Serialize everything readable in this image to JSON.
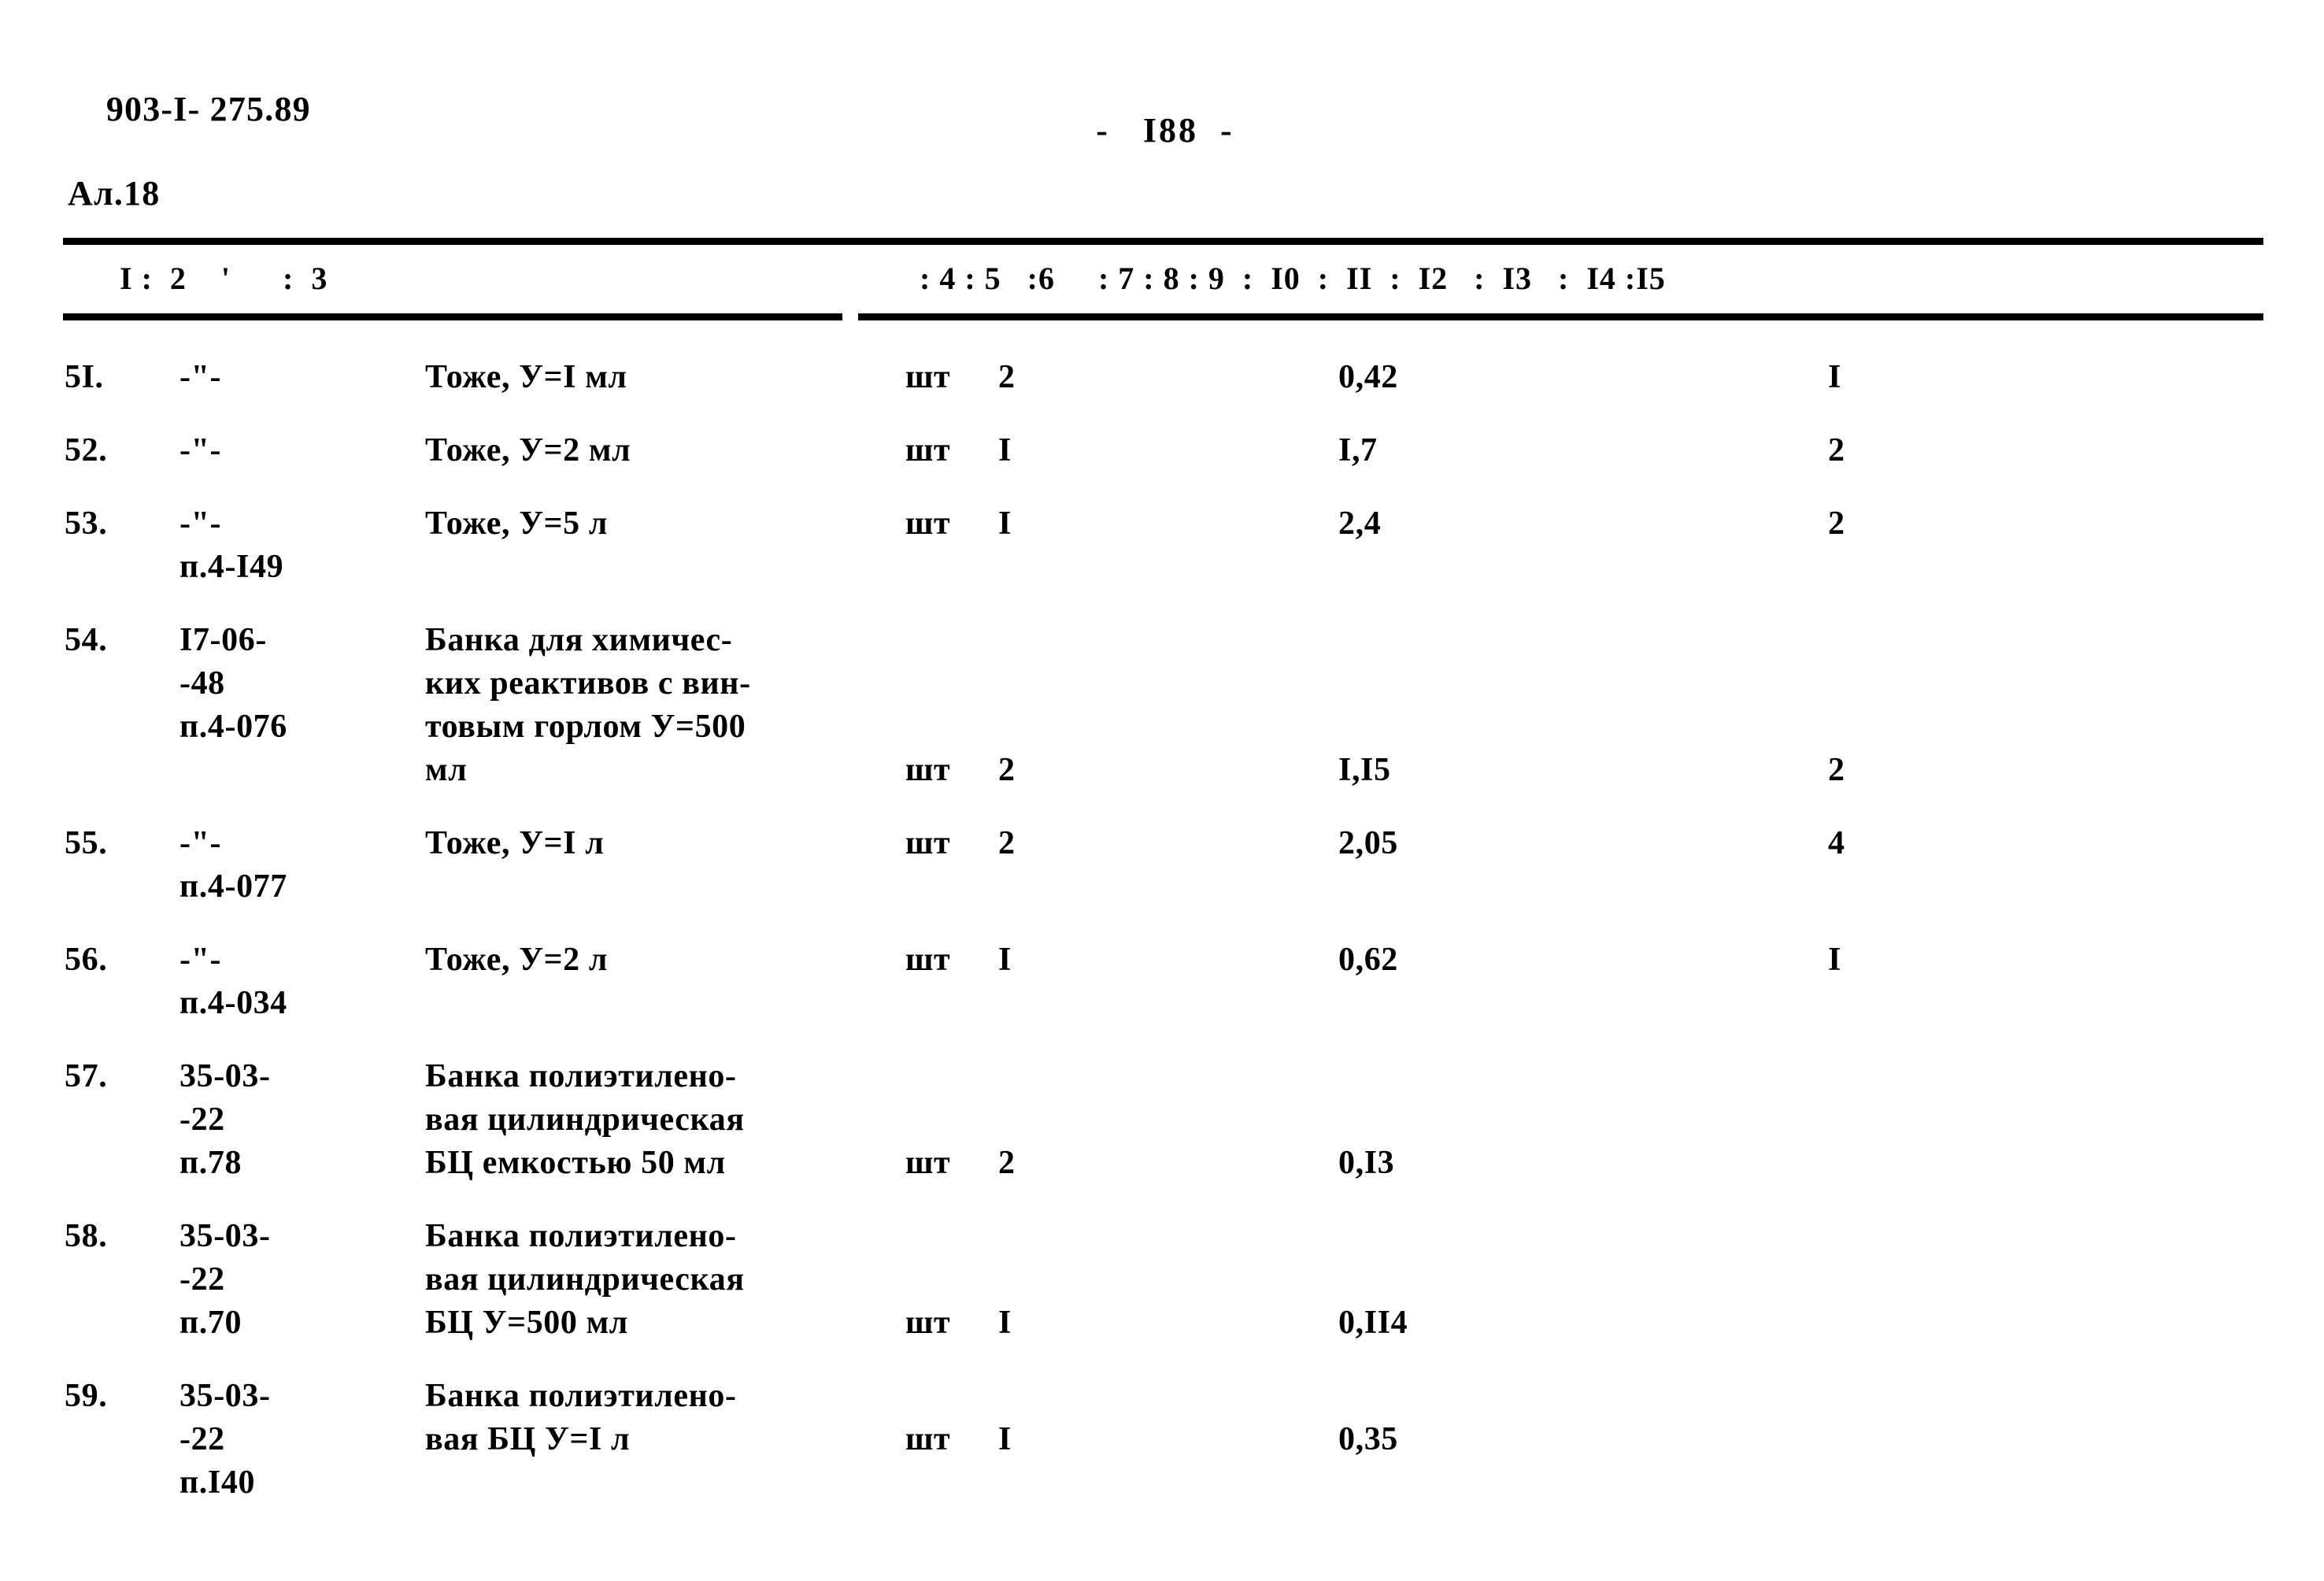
{
  "header": {
    "doc_code_line1": "903-I- 275.89",
    "doc_code_line2": "Ал.18",
    "page_label": "-   I88  -"
  },
  "column_header": {
    "left": "I :  2    '      :  3",
    "right": ": 4 : 5   :6     : 7 : 8 : 9  :  I0  :  II  :  I2   :  I3   :  I4 :I5"
  },
  "table": {
    "rows": [
      {
        "num": "5I.",
        "code": "-\"-",
        "code2": "",
        "desc_lines": [
          "Тоже, У=I мл"
        ],
        "unit": "шт",
        "qty": "2",
        "price": "0,42",
        "col11": "I",
        "unit_line": 0
      },
      {
        "num": "52.",
        "code": "-\"-",
        "code2": "",
        "desc_lines": [
          "Тоже, У=2 мл"
        ],
        "unit": "шт",
        "qty": "I",
        "price": "I,7",
        "col11": "2",
        "unit_line": 0
      },
      {
        "num": "53.",
        "code": "-\"-",
        "code2": "п.4-I49",
        "desc_lines": [
          "Тоже, У=5 л"
        ],
        "unit": "шт",
        "qty": "I",
        "price": "2,4",
        "col11": "2",
        "unit_line": 0
      },
      {
        "num": "54.",
        "code": "I7-06-",
        "code2": "-48\nп.4-076",
        "desc_lines": [
          "Банка для химичес-",
          "ких реактивов с вин-",
          "товым горлом У=500",
          "мл"
        ],
        "unit": "шт",
        "qty": "2",
        "price": "I,I5",
        "col11": "2",
        "unit_line": 3
      },
      {
        "num": "55.",
        "code": "-\"-",
        "code2": "п.4-077",
        "desc_lines": [
          "Тоже, У=I л"
        ],
        "unit": "шт",
        "qty": "2",
        "price": "2,05",
        "col11": "4",
        "unit_line": 0
      },
      {
        "num": "56.",
        "code": "-\"-",
        "code2": "п.4-034",
        "desc_lines": [
          "Тоже, У=2 л"
        ],
        "unit": "шт",
        "qty": "I",
        "price": "0,62",
        "col11": "I",
        "unit_line": 0
      },
      {
        "num": "57.",
        "code": "35-03-",
        "code2": "-22\nп.78",
        "desc_lines": [
          "Банка полиэтилено-",
          "вая цилиндрическая",
          "БЦ емкостью 50 мл"
        ],
        "unit": "шт",
        "qty": "2",
        "price": "0,I3",
        "col11": "",
        "unit_line": 2
      },
      {
        "num": "58.",
        "code": "35-03-",
        "code2": "-22\nп.70",
        "desc_lines": [
          "Банка полиэтилено-",
          "вая цилиндрическая",
          "БЦ У=500 мл"
        ],
        "unit": "шт",
        "qty": "I",
        "price": "0,II4",
        "col11": "",
        "unit_line": 2
      },
      {
        "num": "59.",
        "code": "35-03-",
        "code2": "-22\nп.I40",
        "desc_lines": [
          "Банка полиэтилено-",
          "вая БЦ У=I л"
        ],
        "unit": "шт",
        "qty": "I",
        "price": "0,35",
        "col11": "",
        "unit_line": 1
      }
    ]
  }
}
